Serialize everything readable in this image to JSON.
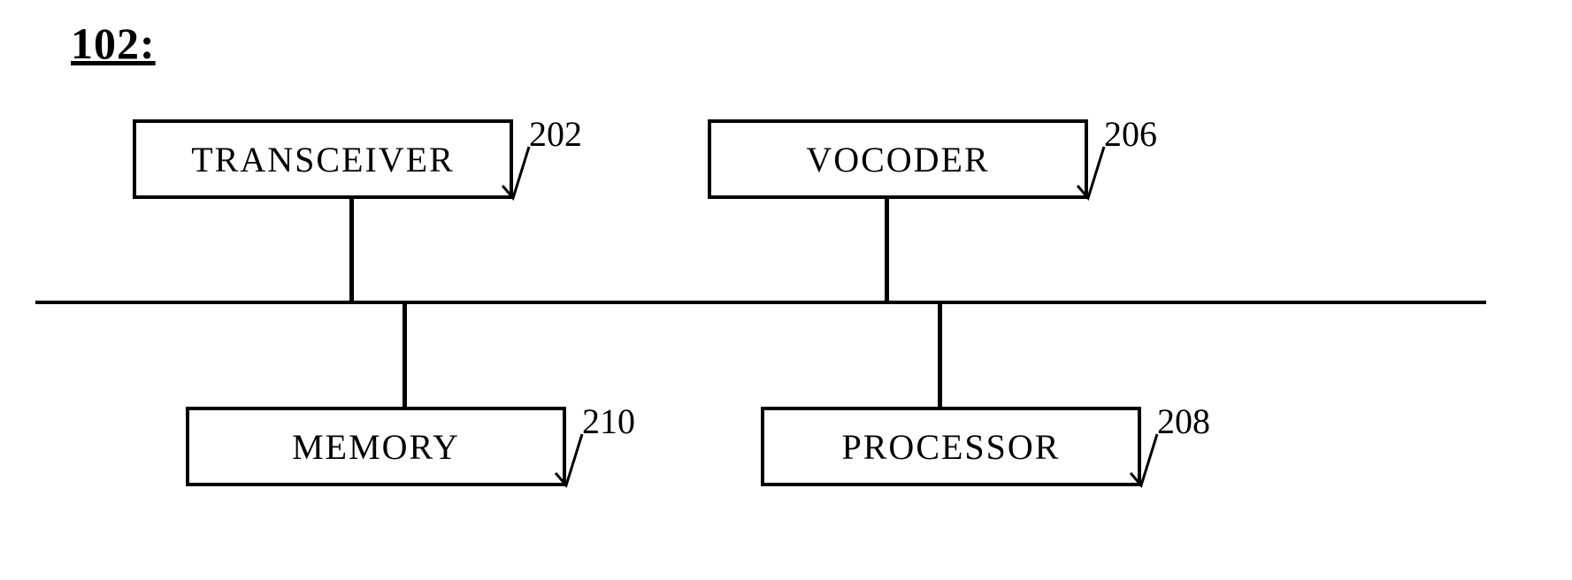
{
  "title": "102:",
  "blocks": {
    "transceiver": {
      "label": "TRANSCEIVER",
      "ref": "202"
    },
    "vocoder": {
      "label": "VOCODER",
      "ref": "206"
    },
    "memory": {
      "label": "MEMORY",
      "ref": "210"
    },
    "processor": {
      "label": "PROCESSOR",
      "ref": "208"
    }
  }
}
